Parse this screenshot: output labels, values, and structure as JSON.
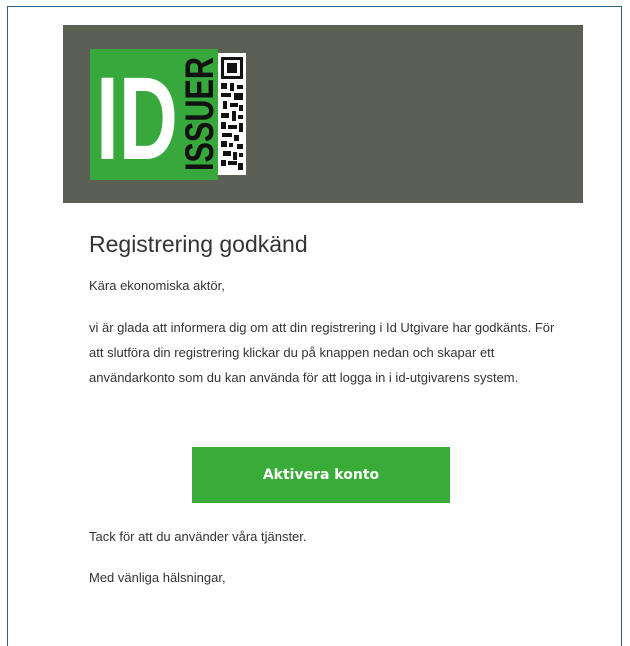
{
  "logo": {
    "text_main": "ID",
    "text_side": "ISSUER"
  },
  "email": {
    "title": "Registrering godkänd",
    "greeting": "Kära ekonomiska aktör,",
    "body": "vi är glada att informera dig om att din registrering i Id Utgivare har godkänts. För att slutföra din registrering klickar du på knappen nedan och skapar ett användarkonto som du kan använda för att logga in i id-utgivarens system.",
    "button_label": "Aktivera konto",
    "thanks": "Tack för att du använder våra tjänster.",
    "regards": "Med vänliga hälsningar,"
  },
  "colors": {
    "banner_bg": "#5b5f54",
    "brand_green": "#37a83b",
    "button_green": "#38ac37",
    "frame_border": "#2a5d84"
  }
}
